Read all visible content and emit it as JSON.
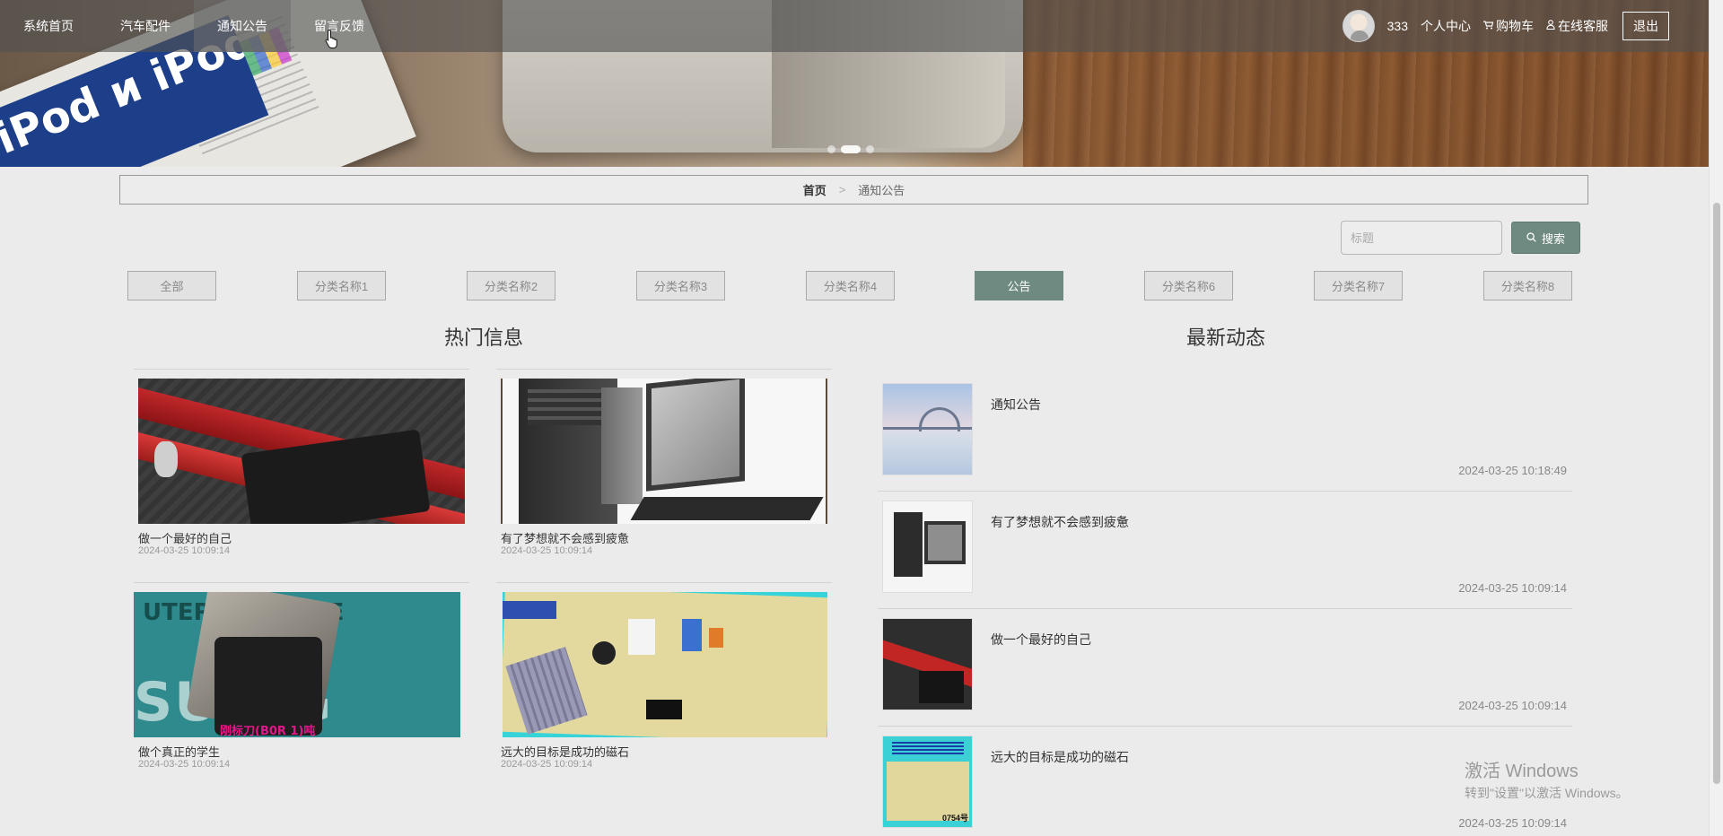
{
  "nav": {
    "items": [
      {
        "label": "系统首页"
      },
      {
        "label": "汽车配件"
      },
      {
        "label": "通知公告"
      },
      {
        "label": "留言反馈"
      }
    ],
    "user": {
      "name": "333",
      "center": "个人中心",
      "cart": "购物车",
      "service": "在线客服",
      "logout": "退出"
    }
  },
  "banner": {
    "book_text": "iPod и iPod m",
    "slides": 3,
    "active_slide": 2
  },
  "breadcrumb": {
    "home": "首页",
    "separator": ">",
    "current": "通知公告"
  },
  "search": {
    "placeholder": "标题",
    "button": "搜索"
  },
  "categories": [
    {
      "label": "全部"
    },
    {
      "label": "分类名称1"
    },
    {
      "label": "分类名称2"
    },
    {
      "label": "分类名称3"
    },
    {
      "label": "分类名称4"
    },
    {
      "label": "公告",
      "active": true
    },
    {
      "label": "分类名称6"
    },
    {
      "label": "分类名称7"
    },
    {
      "label": "分类名称8"
    }
  ],
  "hot": {
    "title": "热门信息",
    "items": [
      {
        "title": "做一个最好的自己",
        "date": "2024-03-25 10:09:14",
        "image": "motherboard"
      },
      {
        "title": "有了梦想就不会感到疲惫",
        "date": "2024-03-25 10:09:14",
        "image": "desktop-computer"
      },
      {
        "title": "做个真正的学生",
        "date": "2024-03-25 10:09:14",
        "image": "machine-part",
        "img_text": "UTERIZ  ACHINE",
        "img_text2": "SU    NG",
        "img_label": "刚标刀(B0R 1)吨"
      },
      {
        "title": "远大的目标是成功的磁石",
        "date": "2024-03-25 10:09:14",
        "image": "circuit-board"
      }
    ]
  },
  "latest": {
    "title": "最新动态",
    "items": [
      {
        "title": "通知公告",
        "date": "2024-03-25 10:18:49",
        "image": "bridge"
      },
      {
        "title": "有了梦想就不会感到疲惫",
        "date": "2024-03-25 10:09:14",
        "image": "desktop-computer"
      },
      {
        "title": "做一个最好的自己",
        "date": "2024-03-25 10:09:14",
        "image": "motherboard"
      },
      {
        "title": "远大的目标是成功的磁石",
        "date": "2024-03-25 10:09:14",
        "image": "circuit-board",
        "tag": "0754号"
      }
    ]
  },
  "watermark": {
    "line1": "激活 Windows",
    "line2": "转到\"设置\"以激活 Windows。"
  },
  "colors": {
    "accent": "#6f8b81",
    "background": "#ebebeb",
    "nav_overlay": "#505050"
  }
}
